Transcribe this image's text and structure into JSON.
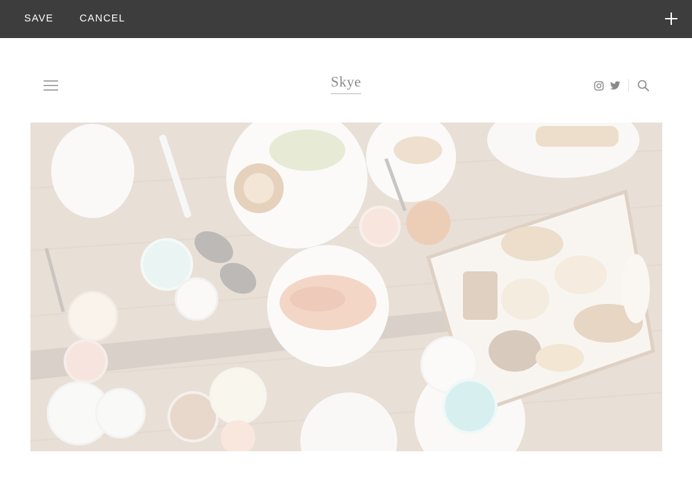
{
  "editbar": {
    "save_label": "SAVE",
    "cancel_label": "CANCEL",
    "add_icon": "plus-icon"
  },
  "header": {
    "menu_icon": "hamburger-menu-icon",
    "logo_text": "Skye",
    "social": [
      "instagram-icon",
      "twitter-icon"
    ],
    "search_icon": "search-icon"
  },
  "hero": {
    "image": "food-table-photo"
  },
  "colors": {
    "editbar_bg": "#3d3d3d",
    "editbar_text": "#ffffff",
    "icon_gray": "#8a8a8a",
    "logo_gray": "#8b8b8b"
  }
}
